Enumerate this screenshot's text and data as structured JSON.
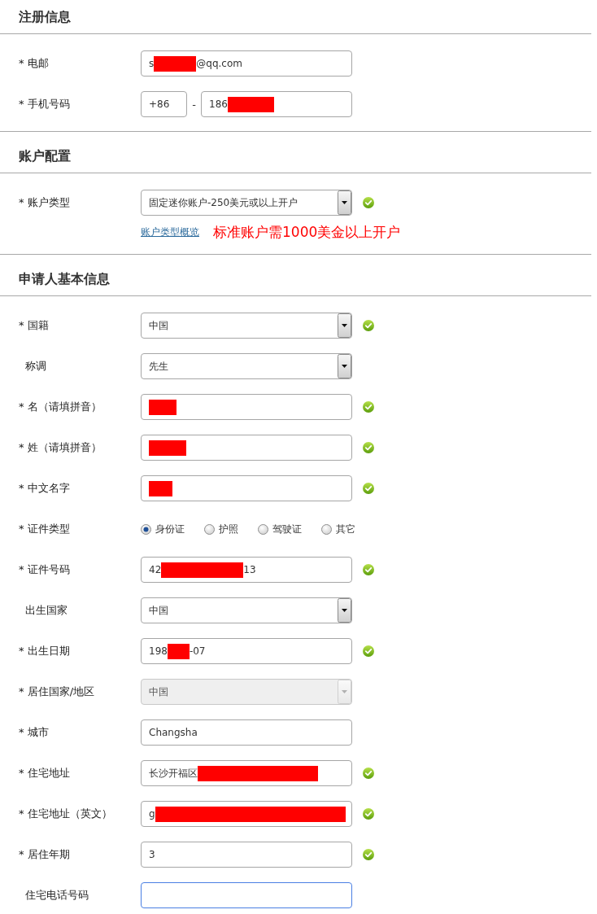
{
  "sections": [
    {
      "title": "注册信息",
      "fields": [
        {
          "label": "* 电邮",
          "required": true,
          "kind": "text",
          "value_parts": [
            {
              "kind": "text",
              "text": "s"
            },
            {
              "kind": "redaction"
            },
            {
              "kind": "text",
              "text": "@qq.com"
            }
          ],
          "valid": false,
          "disabled": false,
          "focused": false
        },
        {
          "label": "* 手机号码",
          "required": true,
          "kind": "phone",
          "prefix": "+86",
          "separator": "-",
          "value_parts": [
            {
              "kind": "text",
              "text": "186"
            },
            {
              "kind": "redaction"
            }
          ],
          "valid": false,
          "disabled": false,
          "focused": false
        }
      ]
    },
    {
      "title": "账户配置",
      "fields": [
        {
          "label": "* 账户类型",
          "required": true,
          "kind": "select",
          "value": "固定迷你账户-250美元或以上开户",
          "valid": true,
          "disabled": false,
          "focused": false,
          "link": "账户类型概览",
          "note": "标准账户需1000美金以上开户"
        }
      ]
    },
    {
      "title": "申请人基本信息",
      "fields": [
        {
          "label": "* 国籍",
          "required": true,
          "kind": "select",
          "value": "中国",
          "valid": true,
          "disabled": false,
          "focused": false
        },
        {
          "label": "称调",
          "required": false,
          "kind": "select",
          "value": "先生",
          "valid": false,
          "disabled": false,
          "focused": false
        },
        {
          "label": "* 名（请填拼音）",
          "required": true,
          "kind": "text",
          "value_parts": [
            {
              "kind": "redaction"
            }
          ],
          "valid": true,
          "disabled": false,
          "focused": false
        },
        {
          "label": "* 姓（请填拼音）",
          "required": true,
          "kind": "text",
          "value_parts": [
            {
              "kind": "redaction"
            }
          ],
          "valid": true,
          "disabled": false,
          "focused": false
        },
        {
          "label": "* 中文名字",
          "required": true,
          "kind": "text",
          "value_parts": [
            {
              "kind": "redaction"
            }
          ],
          "valid": true,
          "disabled": false,
          "focused": false
        },
        {
          "label": "* 证件类型",
          "required": true,
          "kind": "radio",
          "options": [
            {
              "label": "身份证",
              "selected": true
            },
            {
              "label": "护照",
              "selected": false
            },
            {
              "label": "驾驶证",
              "selected": false
            },
            {
              "label": "其它",
              "selected": false
            }
          ],
          "valid": false
        },
        {
          "label": "* 证件号码",
          "required": true,
          "kind": "text",
          "value_parts": [
            {
              "kind": "text",
              "text": "42"
            },
            {
              "kind": "redaction"
            },
            {
              "kind": "text",
              "text": "13"
            }
          ],
          "valid": true,
          "disabled": false,
          "focused": false
        },
        {
          "label": "出生国家",
          "required": false,
          "kind": "select",
          "value": "中国",
          "valid": false,
          "disabled": false,
          "focused": false
        },
        {
          "label": "* 出生日期",
          "required": true,
          "kind": "text",
          "value_parts": [
            {
              "kind": "text",
              "text": "198"
            },
            {
              "kind": "redaction"
            },
            {
              "kind": "text",
              "text": "-07"
            }
          ],
          "valid": true,
          "disabled": false,
          "focused": false
        },
        {
          "label": "* 居住国家/地区",
          "required": true,
          "kind": "select",
          "value": "中国",
          "valid": false,
          "disabled": true,
          "focused": false
        },
        {
          "label": "* 城市",
          "required": true,
          "kind": "text",
          "value": "Changsha",
          "valid": false,
          "disabled": false,
          "focused": false
        },
        {
          "label": "* 住宅地址",
          "required": true,
          "kind": "text",
          "value_parts": [
            {
              "kind": "text",
              "text": "长沙开福区"
            },
            {
              "kind": "redaction"
            }
          ],
          "valid": true,
          "disabled": false,
          "focused": false
        },
        {
          "label": "* 住宅地址（英文）",
          "required": true,
          "kind": "text",
          "value_parts": [
            {
              "kind": "text",
              "text": "g"
            },
            {
              "kind": "redaction"
            }
          ],
          "valid": true,
          "disabled": false,
          "focused": false
        },
        {
          "label": "* 居住年期",
          "required": true,
          "kind": "text",
          "value": "3",
          "valid": true,
          "disabled": false,
          "focused": false
        },
        {
          "label": "住宅电话号码",
          "required": false,
          "kind": "text",
          "valid": false,
          "disabled": false,
          "focused": true
        }
      ]
    }
  ]
}
